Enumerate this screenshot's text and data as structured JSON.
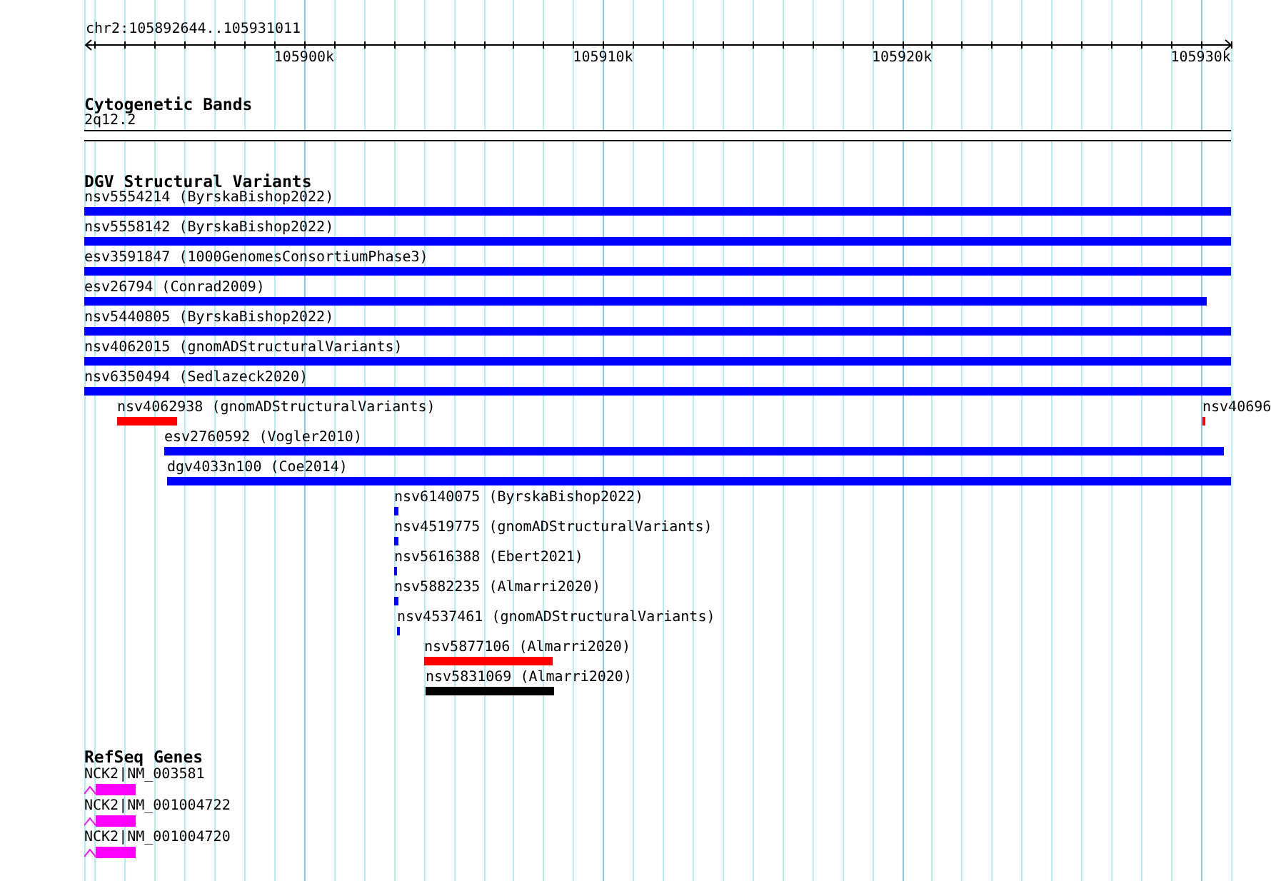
{
  "ruler": {
    "title": "chr2:105892644..105931011",
    "ticks": [
      {
        "label": "105900k"
      },
      {
        "label": "105910k"
      },
      {
        "label": "105920k"
      },
      {
        "label": "105930k"
      }
    ]
  },
  "tracks": [
    {
      "kind": "cytoband",
      "title": "Cytogenetic Bands",
      "bands": [
        {
          "name": "2q12.2"
        }
      ]
    },
    {
      "kind": "variants",
      "title": "DGV Structural Variants",
      "rows": [
        [
          {
            "label": "nsv5554214 (ByrskaBishop2022)",
            "color": "#0000ff"
          }
        ],
        [
          {
            "label": "nsv5558142 (ByrskaBishop2022)",
            "color": "#0000ff"
          }
        ],
        [
          {
            "label": "esv3591847 (1000GenomesConsortiumPhase3)",
            "color": "#0000ff"
          }
        ],
        [
          {
            "label": "esv26794 (Conrad2009)",
            "color": "#0000ff"
          }
        ],
        [
          {
            "label": "nsv5440805 (ByrskaBishop2022)",
            "color": "#0000ff"
          }
        ],
        [
          {
            "label": "nsv4062015 (gnomADStructuralVariants)",
            "color": "#0000ff"
          }
        ],
        [
          {
            "label": "nsv6350494 (Sedlazeck2020)",
            "color": "#0000ff"
          }
        ],
        [
          {
            "label": "nsv4062938 (gnomADStructuralVariants)",
            "color": "#ff0000"
          },
          {
            "label": "nsv40696",
            "color": "#ff0000"
          }
        ],
        [
          {
            "label": "esv2760592 (Vogler2010)",
            "color": "#0000ff"
          }
        ],
        [
          {
            "label": "dgv4033n100 (Coe2014)",
            "color": "#0000ff"
          }
        ],
        [
          {
            "label": "nsv6140075 (ByrskaBishop2022)",
            "color": "#0000ff"
          }
        ],
        [
          {
            "label": "nsv4519775 (gnomADStructuralVariants)",
            "color": "#0000ff"
          }
        ],
        [
          {
            "label": "nsv5616388 (Ebert2021)",
            "color": "#0000ff"
          }
        ],
        [
          {
            "label": "nsv5882235 (Almarri2020)",
            "color": "#0000ff"
          }
        ],
        [
          {
            "label": "nsv4537461 (gnomADStructuralVariants)",
            "color": "#0000ff"
          }
        ],
        [
          {
            "label": "nsv5877106 (Almarri2020)",
            "color": "#ff0000"
          }
        ],
        [
          {
            "label": "nsv5831069 (Almarri2020)",
            "color": "#000000"
          }
        ]
      ]
    },
    {
      "kind": "genes",
      "title": "RefSeq Genes",
      "genes": [
        {
          "label": "NCK2|NM_003581"
        },
        {
          "label": "NCK2|NM_001004722"
        },
        {
          "label": "NCK2|NM_001004720"
        }
      ]
    }
  ]
}
